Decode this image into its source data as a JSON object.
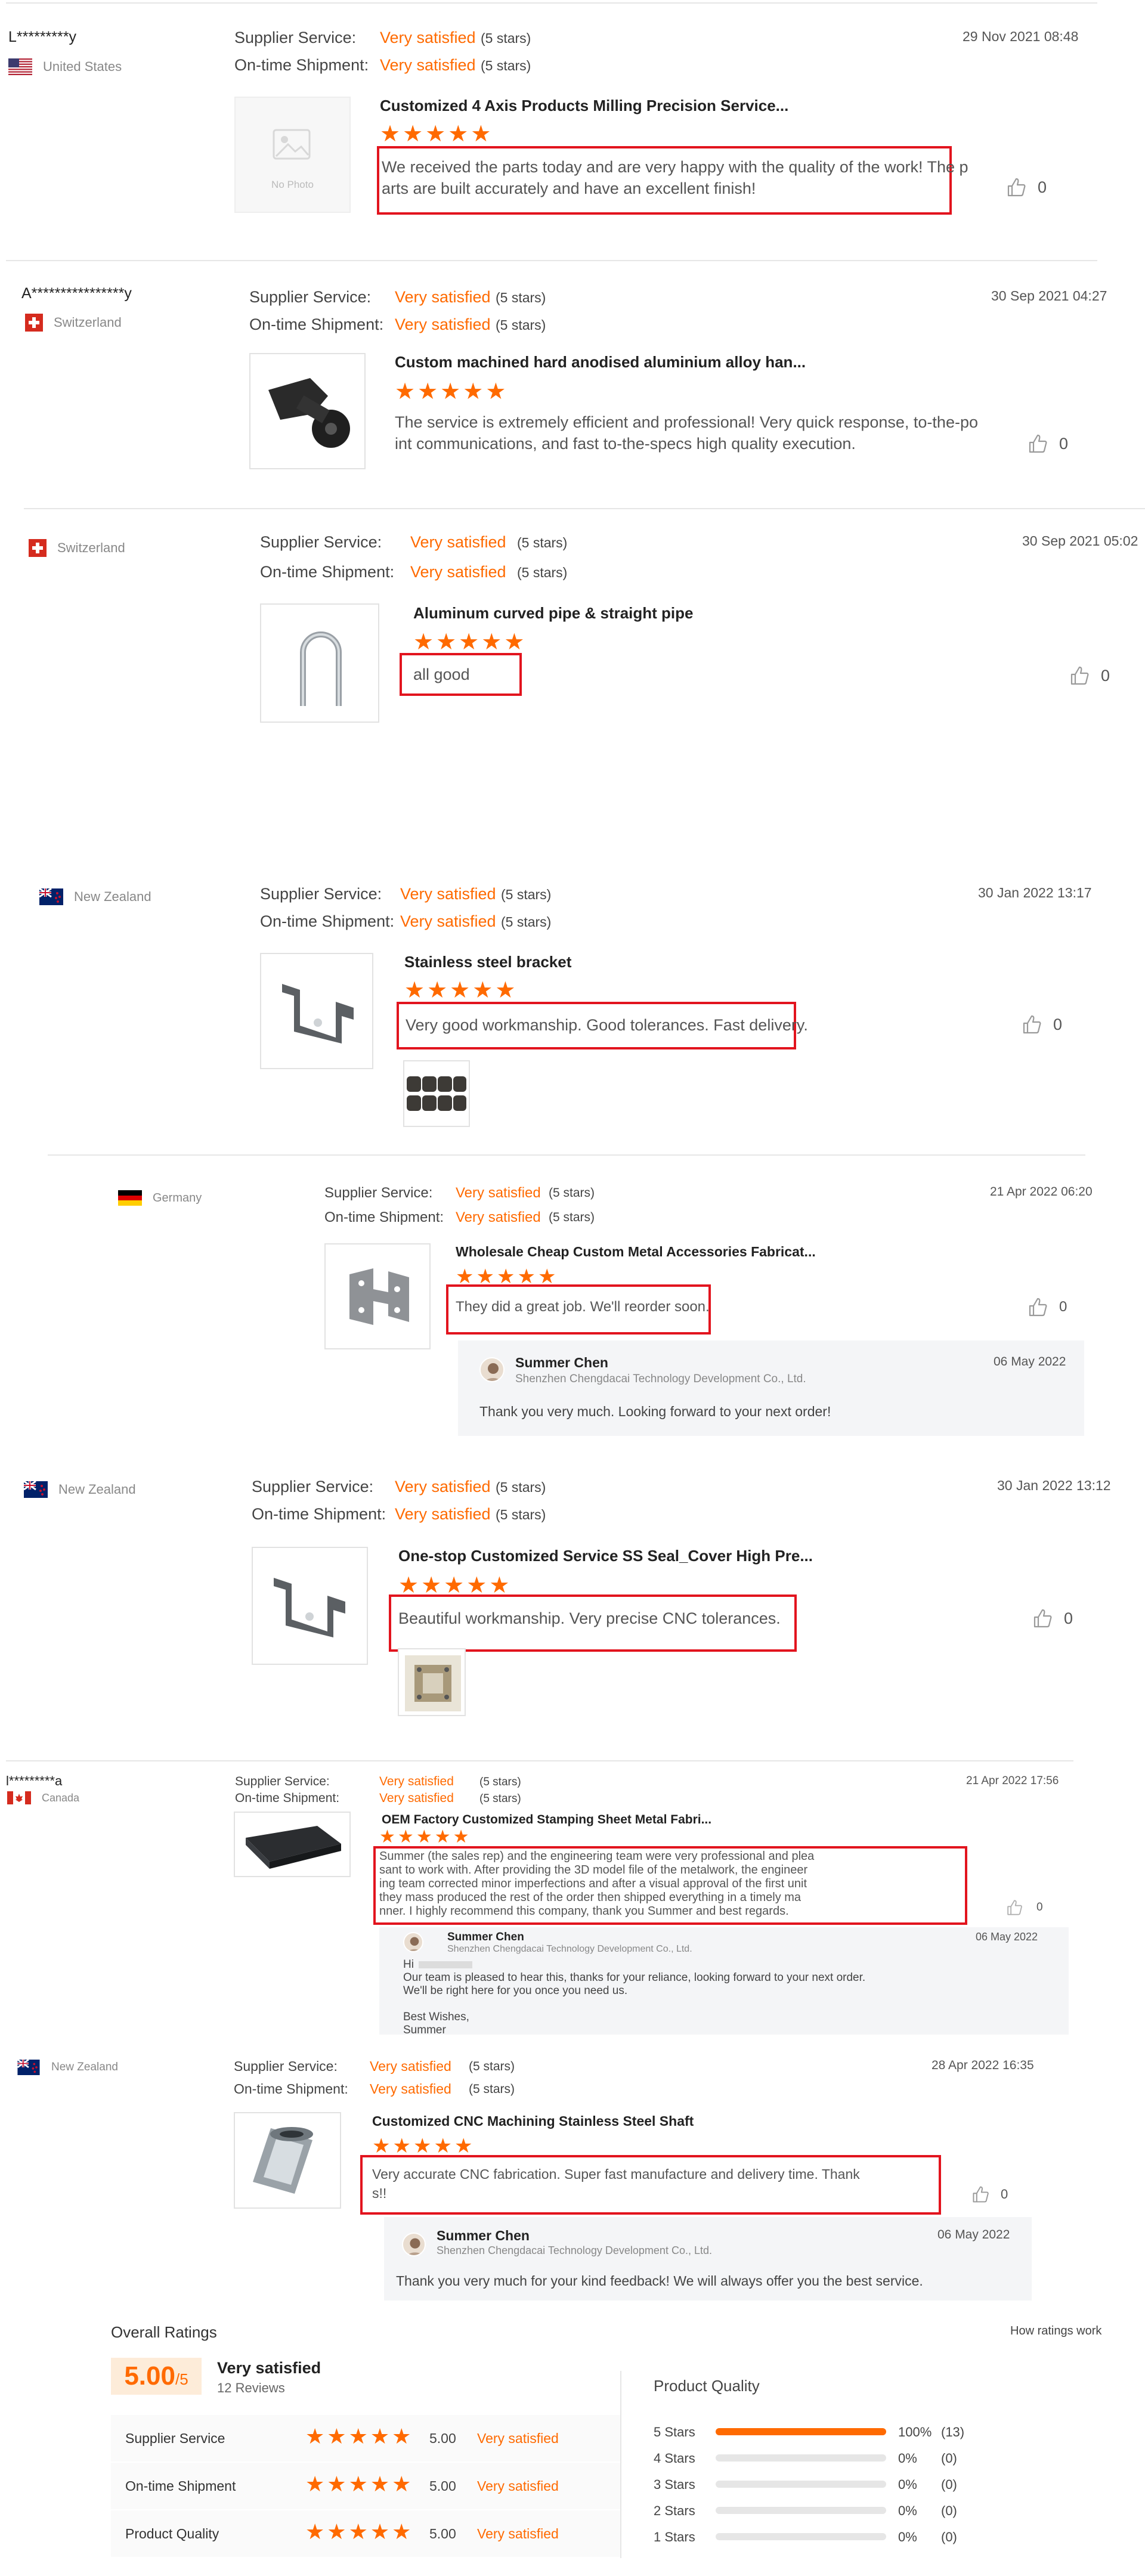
{
  "labels": {
    "supplier_service": "Supplier Service:",
    "on_time": "On-time Shipment:"
  },
  "reviews": [
    {
      "user": "L*********y",
      "country": "United States",
      "supplier_value": "Very satisfied",
      "supplier_stars": "(5 stars)",
      "shipment_value": "Very satisfied",
      "shipment_stars": "(5 stars)",
      "date": "29 Nov 2021 08:48",
      "product": "Customized 4 Axis Products Milling Precision Service...",
      "no_photo": "No Photo",
      "comment_lines": [
        "We received the parts today and are very happy with the quality of the work! The p",
        "arts are built accurately and have an excellent finish!"
      ],
      "likes": "0",
      "rating": 5
    },
    {
      "user": "A****************y",
      "country": "Switzerland",
      "supplier_value": "Very satisfied",
      "supplier_stars": "(5 stars)",
      "shipment_value": "Very satisfied",
      "shipment_stars": "(5 stars)",
      "date": "30 Sep 2021 04:27",
      "product": "Custom machined hard anodised aluminium alloy han...",
      "comment_lines": [
        "The service is extremely efficient and professional! Very quick response, to-the-po",
        "int communications, and fast to-the-specs high quality execution."
      ],
      "likes": "0",
      "rating": 5
    },
    {
      "user": "",
      "country": "Switzerland",
      "supplier_value": "Very satisfied",
      "supplier_stars": "(5 stars)",
      "shipment_value": "Very satisfied",
      "shipment_stars": "(5 stars)",
      "date": "30 Sep 2021 05:02",
      "product": "Aluminum curved pipe & straight pipe",
      "comment_lines": [
        "all good"
      ],
      "likes": "0",
      "rating": 5
    },
    {
      "user": "",
      "country": "New Zealand",
      "supplier_value": "Very satisfied",
      "supplier_stars": "(5 stars)",
      "shipment_value": "Very satisfied",
      "shipment_stars": "(5 stars)",
      "date": "30 Jan 2022 13:17",
      "product": "Stainless steel bracket",
      "comment_lines": [
        "Very good workmanship. Good tolerances. Fast delivery."
      ],
      "likes": "0",
      "rating": 5
    },
    {
      "user": "",
      "country": "Germany",
      "supplier_value": "Very satisfied",
      "supplier_stars": "(5 stars)",
      "shipment_value": "Very satisfied",
      "shipment_stars": "(5 stars)",
      "date": "21 Apr 2022 06:20",
      "product": "Wholesale Cheap Custom Metal Accessories Fabricat...",
      "comment_lines": [
        "They did a great job. We'll reorder soon."
      ],
      "likes": "0",
      "rating": 5,
      "reply": {
        "name": "Summer Chen",
        "company": "Shenzhen Chengdacai Technology Development Co., Ltd.",
        "date": "06 May 2022",
        "lines": [
          "Thank you very much. Looking forward to your next order!"
        ]
      }
    },
    {
      "user": "",
      "country": "New Zealand",
      "supplier_value": "Very satisfied",
      "supplier_stars": "(5 stars)",
      "shipment_value": "Very satisfied",
      "shipment_stars": "(5 stars)",
      "date": "30 Jan 2022 13:12",
      "product": "One-stop Customized Service SS Seal_Cover High Pre...",
      "comment_lines": [
        "Beautiful workmanship. Very precise CNC tolerances."
      ],
      "likes": "0",
      "rating": 5
    },
    {
      "user": "l*********a",
      "country": "Canada",
      "supplier_value": "Very satisfied",
      "supplier_stars": "(5 stars)",
      "shipment_value": "Very satisfied",
      "shipment_stars": "(5 stars)",
      "date": "21 Apr 2022 17:56",
      "product": "OEM Factory Customized Stamping Sheet Metal Fabri...",
      "comment_lines": [
        "Summer (the sales rep) and the engineering team were very professional and plea",
        "sant to work with. After providing the 3D model file of the metalwork, the engineer",
        "ing team corrected minor imperfections and after a visual approval of the first unit",
        "they mass produced the rest of the order then shipped everything in a timely ma",
        "nner. I highly recommend this company, thank you Summer and best regards."
      ],
      "likes": "0",
      "rating": 5,
      "reply": {
        "name": "Summer Chen",
        "company": "Shenzhen Chengdacai Technology Development Co., Ltd.",
        "date": "06 May 2022",
        "lines": [
          "Hi",
          "Our team is pleased to hear this, thanks for your reliance, looking forward to your next order.",
          "We'll be right here for you once you need us.",
          "",
          "Best Wishes,",
          "Summer"
        ]
      }
    },
    {
      "user": "",
      "country": "New Zealand",
      "supplier_value": "Very satisfied",
      "supplier_stars": "(5 stars)",
      "shipment_value": "Very satisfied",
      "shipment_stars": "(5 stars)",
      "date": "28 Apr 2022 16:35",
      "product": "Customized CNC Machining Stainless Steel Shaft",
      "comment_lines": [
        "Very accurate CNC fabrication. Super fast manufacture and delivery time. Thank",
        "s!!"
      ],
      "likes": "0",
      "rating": 5,
      "reply": {
        "name": "Summer Chen",
        "company": "Shenzhen Chengdacai Technology Development Co., Ltd.",
        "date": "06 May 2022",
        "lines": [
          "Thank you very much for your kind feedback!  We will always offer you the best service."
        ]
      }
    }
  ],
  "overall": {
    "title": "Overall Ratings",
    "how": "How ratings work",
    "score": "5.00",
    "score_suffix": "/5",
    "label": "Very satisfied",
    "count": "12 Reviews",
    "rows": [
      {
        "name": "Supplier Service",
        "score": "5.00",
        "label": "Very satisfied",
        "rating": 5
      },
      {
        "name": "On-time Shipment",
        "score": "5.00",
        "label": "Very satisfied",
        "rating": 5
      },
      {
        "name": "Product Quality",
        "score": "5.00",
        "label": "Very satisfied",
        "rating": 5
      }
    ],
    "pq_title": "Product Quality",
    "pq": [
      {
        "label": "5 Stars",
        "pct": "100%",
        "count": "(13)",
        "fraction": 1.0
      },
      {
        "label": "4 Stars",
        "pct": "0%",
        "count": "(0)",
        "fraction": 0
      },
      {
        "label": "3 Stars",
        "pct": "0%",
        "count": "(0)",
        "fraction": 0
      },
      {
        "label": "2 Stars",
        "pct": "0%",
        "count": "(0)",
        "fraction": 0
      },
      {
        "label": "1 Stars",
        "pct": "0%",
        "count": "(0)",
        "fraction": 0
      }
    ]
  },
  "colors": {
    "accent": "#ff6a00",
    "highlight_box": "#e2141e",
    "reply_bg": "#f4f5f7",
    "bar_track": "#e6e6e6"
  }
}
